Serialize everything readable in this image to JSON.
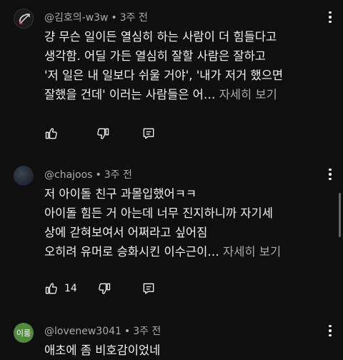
{
  "comments": [
    {
      "author": "@김호의-w3w",
      "time": "3주 전",
      "lines": [
        "걍 무슨 일이든 열심히 하는 사람이 더 힘들다고",
        "생각함. 어딜 가든 열심히 잘할 사람은 잘하고",
        "'저 일은 내 일보다 쉬울 거야', '내가 저거 했으면",
        "잘했을 건데' 이러는 사람들은 어…"
      ],
      "more_label": "자세히 보기",
      "like_count": ""
    },
    {
      "author": "@chajoos",
      "time": "3주 전",
      "lines": [
        "저 아이돌 친구 과몰입했어ㅋㅋ",
        "아이돌 힘든 거 아는데 너무 진지하니까 자기세",
        "상에 갇혀보여서  어쩌라고 싶어짐",
        "오히려 유머로 승화시킨 이수근이…"
      ],
      "more_label": "자세히 보기",
      "like_count": "14"
    },
    {
      "author": "@lovenew3041",
      "time": "3주 전",
      "avatar_text": "이룸",
      "lines": [
        "애초에 좀 비호감이었네"
      ]
    }
  ],
  "colors": {
    "background": "#0f0f0f",
    "text": "#f1f1f1",
    "muted": "#aaaaaa",
    "avatar_green": "#4f8c3a"
  },
  "icons": [
    "like-icon",
    "dislike-icon",
    "reply-icon",
    "more-options-icon"
  ]
}
